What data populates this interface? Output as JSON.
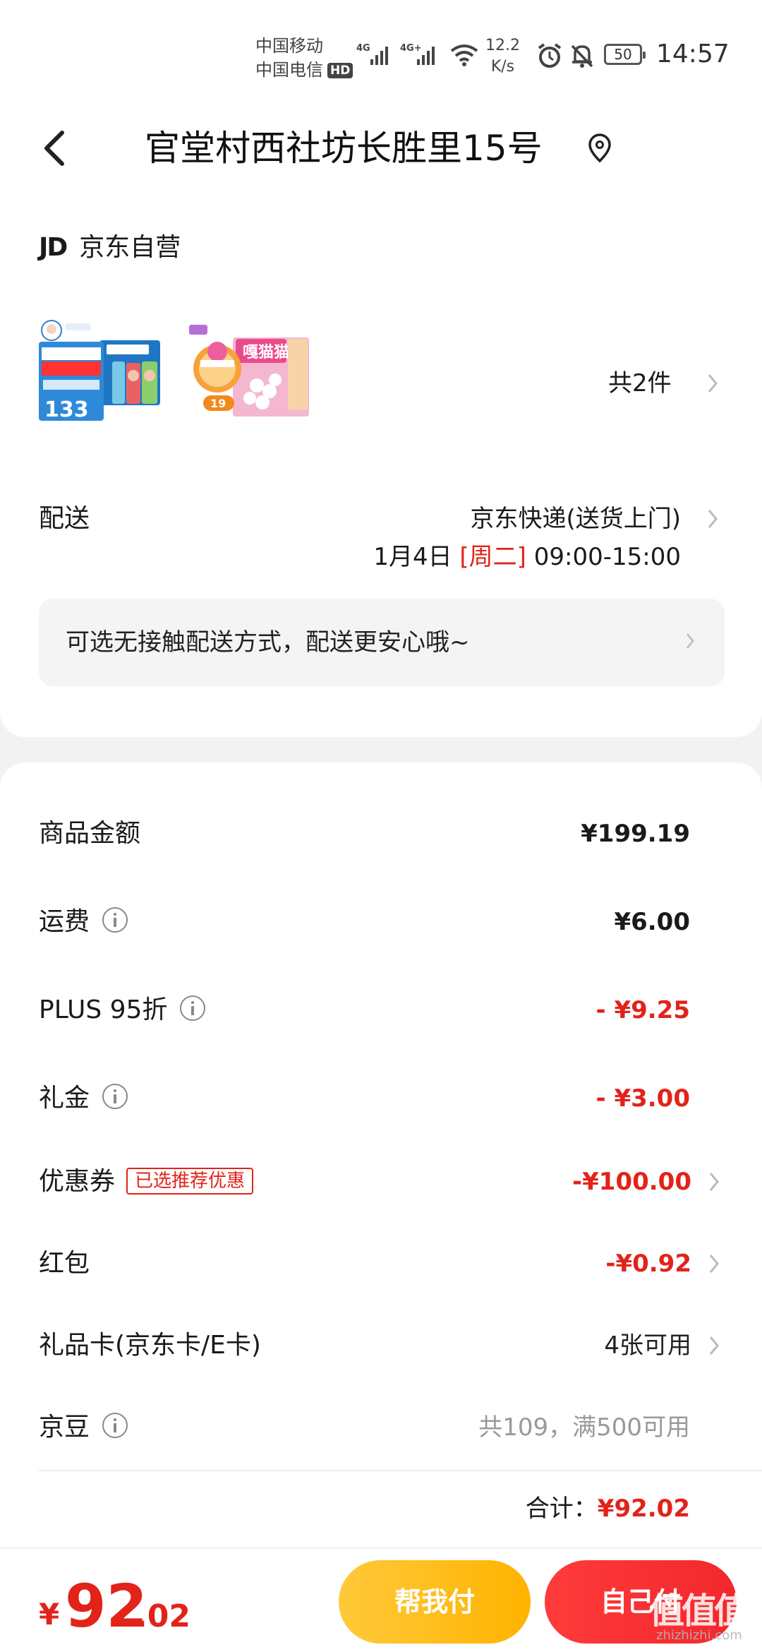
{
  "status_bar": {
    "carrier1": "中国移动",
    "carrier2": "中国电信",
    "hd": "HD",
    "signal1": "4G",
    "signal2": "4G+",
    "speed_value": "12.2",
    "speed_unit": "K/s",
    "battery": "50",
    "time": "14:57"
  },
  "header": {
    "address": "官堂村西社坊长胜里15号"
  },
  "order": {
    "shop_logo": "JD",
    "shop_name": "京东自营",
    "product1_price_tag": "133",
    "product2_price_tag": "19",
    "product2_brand": "嘎猫猫",
    "item_count": "共2件",
    "delivery_label": "配送",
    "delivery_method": "京东快递(送货上门)",
    "delivery_date": "1月4日",
    "delivery_day": "[周二]",
    "delivery_time": "09:00-15:00",
    "contactless_text": "可选无接触配送方式，配送更安心哦~"
  },
  "price": {
    "goods_label": "商品金额",
    "goods_value": "¥199.19",
    "shipping_label": "运费",
    "shipping_value": "¥6.00",
    "plus_label": "PLUS 95折",
    "plus_value": "- ¥9.25",
    "gift_label": "礼金",
    "gift_value": "- ¥3.00",
    "coupon_label": "优惠券",
    "coupon_tag": "已选推荐优惠",
    "coupon_value": "-¥100.00",
    "redpacket_label": "红包",
    "redpacket_value": "-¥0.92",
    "giftcard_label": "礼品卡(京东卡/E卡)",
    "giftcard_value": "4张可用",
    "jingdou_label": "京豆",
    "jingdou_value": "共109，满500可用",
    "total_label": "合计：",
    "total_value": "¥92.02"
  },
  "bottom": {
    "pay_yen": "¥",
    "pay_int": "92",
    "pay_dec": ".02",
    "help_pay": "帮我付",
    "self_pay": "自己付",
    "watermark": "值值值",
    "watermark_sub": "zhizhizhi.com"
  },
  "colors": {
    "accent_red": "#e2231a",
    "help_yellow": "#ffb300",
    "pay_red": "#f2272c"
  }
}
